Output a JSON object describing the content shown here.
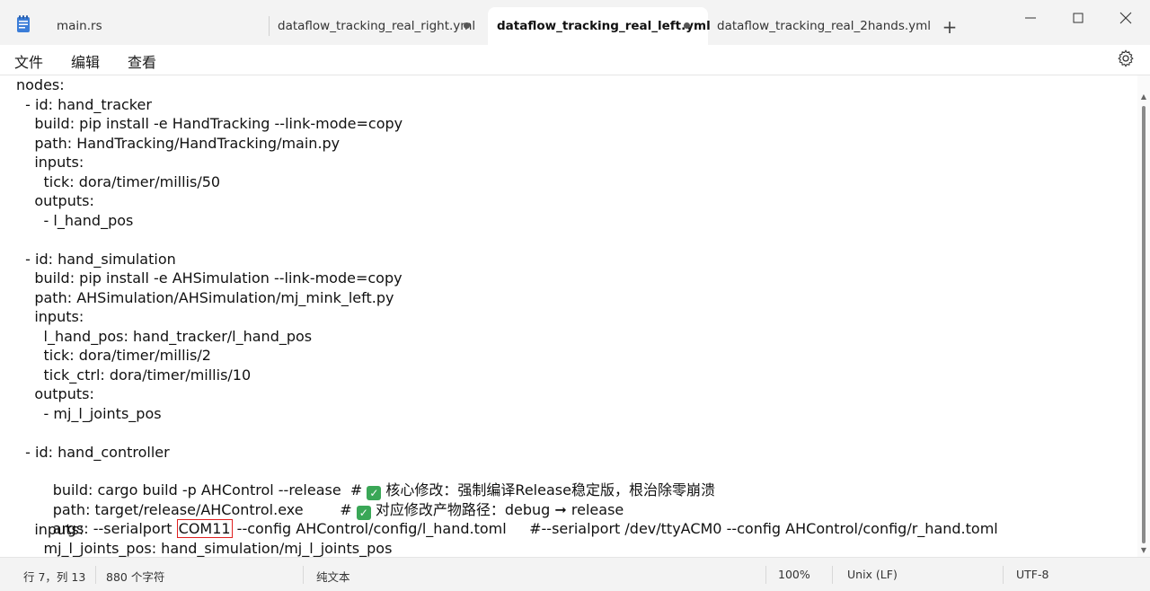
{
  "tabs": [
    {
      "label": "main.rs",
      "modified": false
    },
    {
      "label": "dataflow_tracking_real_right.yml",
      "modified": true
    },
    {
      "label": "dataflow_tracking_real_left.yml",
      "modified": true,
      "active": true
    },
    {
      "label": "dataflow_tracking_real_2hands.yml",
      "modified": false
    }
  ],
  "new_tab_label": "+",
  "menu": {
    "file": "文件",
    "edit": "编辑",
    "view": "查看"
  },
  "editor": {
    "lines": [
      "nodes:",
      "  - id: hand_tracker",
      "    build: pip install -e HandTracking --link-mode=copy",
      "    path: HandTracking/HandTracking/main.py",
      "    inputs:",
      "      tick: dora/timer/millis/50",
      "    outputs:",
      "      - l_hand_pos",
      "",
      "  - id: hand_simulation",
      "    build: pip install -e AHSimulation --link-mode=copy",
      "    path: AHSimulation/AHSimulation/mj_mink_left.py",
      "    inputs:",
      "      l_hand_pos: hand_tracker/l_hand_pos",
      "      tick: dora/timer/millis/2",
      "      tick_ctrl: dora/timer/millis/10",
      "    outputs:",
      "      - mj_l_joints_pos",
      "",
      "  - id: hand_controller"
    ],
    "line21": {
      "before": "    build: cargo build -p AHControl --release  # ",
      "after": " 核心修改：强制编译Release稳定版，根治除零崩溃"
    },
    "line22": {
      "before": "    path: target/release/AHControl.exe        # ",
      "after": " 对应修改产物路径：debug ➞ release"
    },
    "line23": {
      "before": "    args: --serialport ",
      "highlight": "COM11",
      "after": " --config AHControl/config/l_hand.toml     #--serialport /dev/ttyACM0 --config AHControl/config/r_hand.toml"
    },
    "line24": "    inputs:",
    "line25": "      mj_l_joints_pos: hand_simulation/mj_l_joints_pos",
    "check_glyph": "✓"
  },
  "status": {
    "position": "行 7，列 13",
    "char_count": "880 个字符",
    "format": "纯文本",
    "zoom": "100%",
    "line_ending": "Unix (LF)",
    "encoding": "UTF-8"
  },
  "colors": {
    "accent_check": "#3aa757",
    "highlight_box": "#e02020"
  }
}
